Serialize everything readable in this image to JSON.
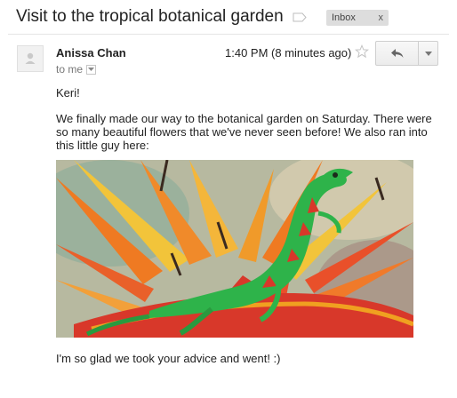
{
  "message": {
    "subject": "Visit to the tropical botanical garden",
    "labels": [
      {
        "name": "Inbox",
        "remove": "x"
      }
    ],
    "sender": "Anissa Chan",
    "recipient": "to me",
    "timestamp": "1:40 PM (8 minutes ago)",
    "body": {
      "greeting": "Keri!",
      "paragraph": "We finally made our way to the botanical garden on Saturday. There were so many beautiful flowers that we've never seen before! We also ran into this little guy here:",
      "closing": "I'm so glad we took your advice and went! :)"
    }
  },
  "icons": {
    "label": "label-tag-icon",
    "star": "star-outline-icon",
    "reply": "reply-arrow-icon",
    "more": "chevron-down-icon",
    "details": "chevron-down-icon",
    "avatar": "person-silhouette-icon"
  },
  "colors": {
    "lizard": "#2eb34a",
    "lizard_red": "#d8382a",
    "petal_orange": "#ef7a22",
    "petal_yellow": "#f2c43a"
  }
}
